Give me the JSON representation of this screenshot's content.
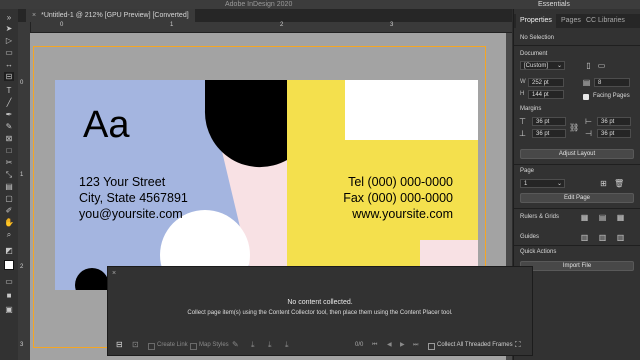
{
  "app": {
    "title": "Adobe InDesign 2020",
    "workspace": "Essentials"
  },
  "document_tab": {
    "label": "*Untitled-1 @ 212% [GPU Preview] [Converted]"
  },
  "rulers": {
    "horizontal": [
      "0",
      "1",
      "2",
      "3"
    ],
    "vertical": [
      "0",
      "1",
      "2",
      "3"
    ]
  },
  "card": {
    "monogram": "Aa",
    "address_line1": "123 Your Street",
    "address_line2": "City, State 4567891",
    "email": "you@yoursite.com",
    "tel": "Tel (000) 000-0000",
    "fax": "Fax (000) 000-0000",
    "website": "www.yoursite.com",
    "colors": {
      "blue": "#a4b5e0",
      "black": "#000000",
      "yellow": "#f4e04d",
      "pink": "#f8e1e4",
      "white": "#ffffff"
    }
  },
  "panel": {
    "tabs": [
      "Properties",
      "Pages",
      "CC Libraries"
    ],
    "no_selection": "No Selection",
    "document_label": "Document",
    "preset": "[Custom]",
    "width_label": "W",
    "width": "252 pt",
    "height_label": "H",
    "height": "144 pt",
    "pages_count": "8",
    "facing_pages": "Facing Pages",
    "margins_label": "Margins",
    "margins": [
      "36 pt",
      "36 pt",
      "36 pt",
      "36 pt"
    ],
    "adjust_layout": "Adjust Layout",
    "page_label": "Page",
    "page_value": "1",
    "edit_page": "Edit Page",
    "rulers_grids": "Rulers & Grids",
    "guides": "Guides",
    "quick_actions": "Quick Actions",
    "import_file": "Import File"
  },
  "collector": {
    "title": "No content collected.",
    "message": "Collect page item(s) using the Content Collector tool, then place them using the Content Placer tool.",
    "create_link": "Create Link",
    "map_styles": "Map Styles",
    "counter": "0/0",
    "collect_threaded": "Collect All Threaded Frames"
  }
}
